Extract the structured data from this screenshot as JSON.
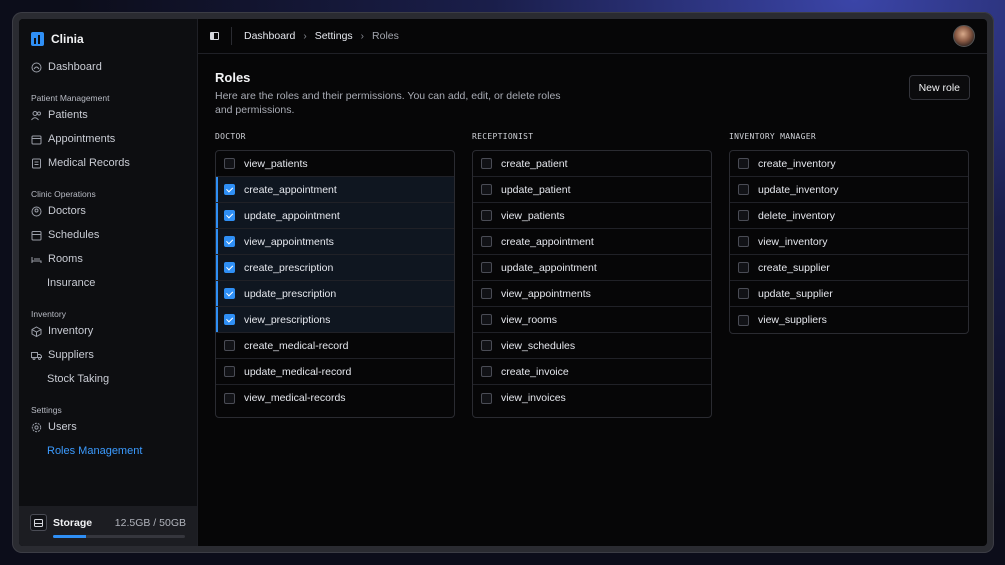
{
  "brand": {
    "name": "Clinia"
  },
  "sidebar": {
    "top": [
      {
        "label": "Dashboard",
        "icon": "gauge-icon"
      }
    ],
    "sections": [
      {
        "title": "Patient Management",
        "items": [
          {
            "label": "Patients",
            "icon": "users-icon"
          },
          {
            "label": "Appointments",
            "icon": "calendar-icon"
          },
          {
            "label": "Medical Records",
            "icon": "records-icon"
          }
        ]
      },
      {
        "title": "Clinic Operations",
        "items": [
          {
            "label": "Doctors",
            "icon": "doctor-icon"
          },
          {
            "label": "Schedules",
            "icon": "schedule-icon"
          },
          {
            "label": "Rooms",
            "icon": "bed-icon"
          },
          {
            "label": "Insurance",
            "icon": ""
          }
        ]
      },
      {
        "title": "Inventory",
        "items": [
          {
            "label": "Inventory",
            "icon": "box-icon"
          },
          {
            "label": "Suppliers",
            "icon": "truck-icon"
          },
          {
            "label": "Stock Taking",
            "icon": ""
          }
        ]
      },
      {
        "title": "Settings",
        "items": [
          {
            "label": "Users",
            "icon": "gear-icon"
          },
          {
            "label": "Roles Management",
            "icon": "",
            "active": true
          }
        ]
      }
    ]
  },
  "storage": {
    "label": "Storage",
    "value": "12.5GB / 50GB",
    "fraction": 0.25
  },
  "breadcrumb": [
    "Dashboard",
    "Settings",
    "Roles"
  ],
  "page": {
    "title": "Roles",
    "description": "Here are the roles and their permissions. You can add, edit, or delete roles and permissions.",
    "new_role_label": "New role"
  },
  "roles": [
    {
      "name": "DOCTOR",
      "permissions": [
        {
          "name": "view_patients",
          "checked": false
        },
        {
          "name": "create_appointment",
          "checked": true
        },
        {
          "name": "update_appointment",
          "checked": true
        },
        {
          "name": "view_appointments",
          "checked": true
        },
        {
          "name": "create_prescription",
          "checked": true
        },
        {
          "name": "update_prescription",
          "checked": true
        },
        {
          "name": "view_prescriptions",
          "checked": true
        },
        {
          "name": "create_medical-record",
          "checked": false
        },
        {
          "name": "update_medical-record",
          "checked": false
        },
        {
          "name": "view_medical-records",
          "checked": false
        }
      ]
    },
    {
      "name": "RECEPTIONIST",
      "permissions": [
        {
          "name": "create_patient",
          "checked": false
        },
        {
          "name": "update_patient",
          "checked": false
        },
        {
          "name": "view_patients",
          "checked": false
        },
        {
          "name": "create_appointment",
          "checked": false
        },
        {
          "name": "update_appointment",
          "checked": false
        },
        {
          "name": "view_appointments",
          "checked": false
        },
        {
          "name": "view_rooms",
          "checked": false
        },
        {
          "name": "view_schedules",
          "checked": false
        },
        {
          "name": "create_invoice",
          "checked": false
        },
        {
          "name": "view_invoices",
          "checked": false
        }
      ]
    },
    {
      "name": "INVENTORY MANAGER",
      "permissions": [
        {
          "name": "create_inventory",
          "checked": false
        },
        {
          "name": "update_inventory",
          "checked": false
        },
        {
          "name": "delete_inventory",
          "checked": false
        },
        {
          "name": "view_inventory",
          "checked": false
        },
        {
          "name": "create_supplier",
          "checked": false
        },
        {
          "name": "update_supplier",
          "checked": false
        },
        {
          "name": "view_suppliers",
          "checked": false
        }
      ]
    }
  ],
  "colors": {
    "accent": "#2f8ff5",
    "background": "#060607",
    "sidebar": "#0d0e11"
  }
}
